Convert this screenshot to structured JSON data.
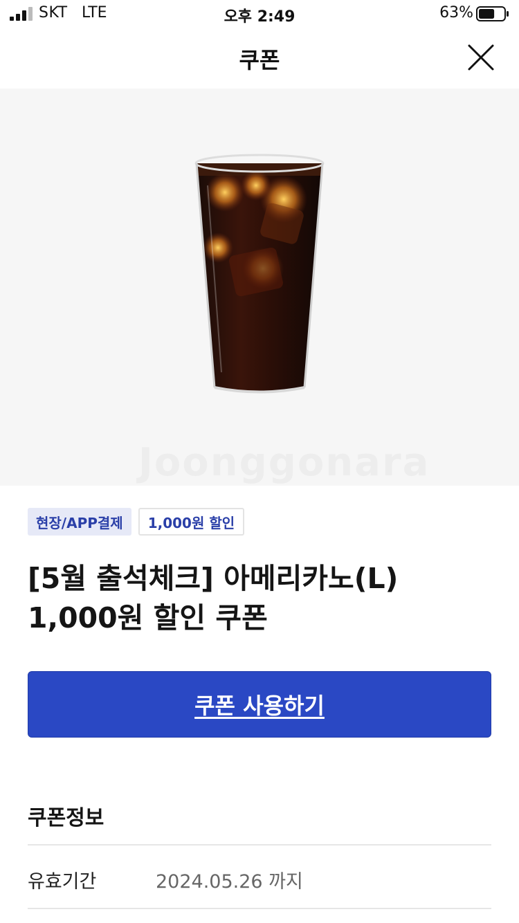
{
  "status_bar": {
    "carrier": "SKT",
    "network": "LTE",
    "time": "오후 2:49",
    "battery_percent": "63%",
    "battery_level": 0.63,
    "signal_icon": "cellular-signal-icon"
  },
  "nav": {
    "title": "쿠폰",
    "close_icon": "close-icon"
  },
  "hero": {
    "image_subject": "iced-americano-image",
    "watermark": "Joonggonara"
  },
  "badges": [
    {
      "label": "현장/APP결제"
    },
    {
      "label": "1,000원 할인"
    }
  ],
  "coupon": {
    "title_line1": "[5월 출석체크] 아메리카노(L)",
    "title_line2": "1,000원 할인 쿠폰"
  },
  "actions": {
    "use_label": "쿠폰 사용하기"
  },
  "info": {
    "section_title": "쿠폰정보",
    "rows": [
      {
        "label": "유효기간",
        "value": "2024.05.26 까지"
      }
    ]
  },
  "colors": {
    "accent": "#2a48c4",
    "badge_text": "#2a3fa8",
    "badge_bg": "#e6e9f7",
    "hero_bg": "#f6f6f6"
  }
}
